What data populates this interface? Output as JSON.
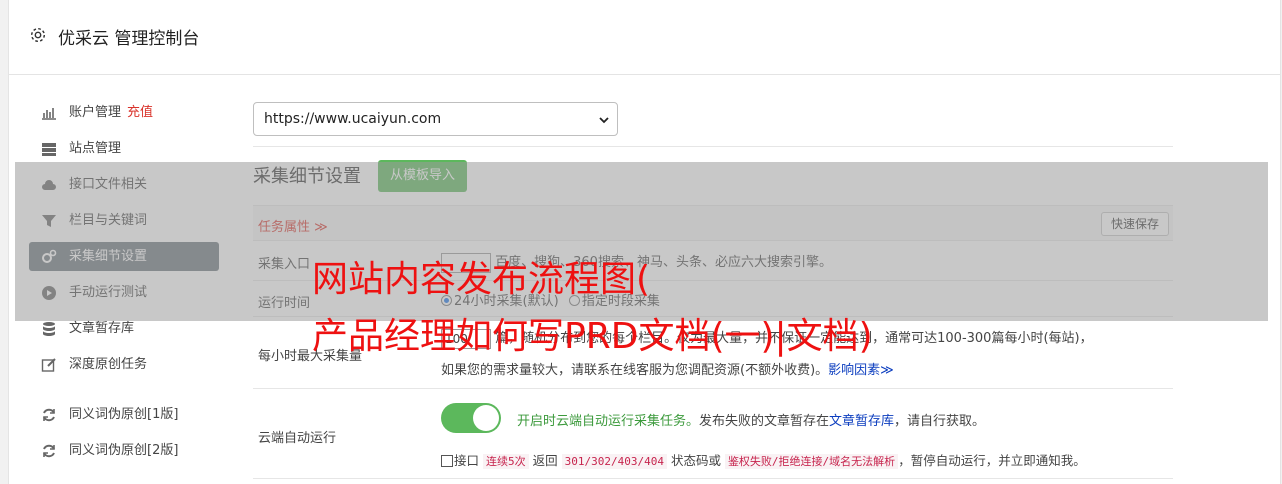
{
  "header": {
    "title": "优采云 管理控制台"
  },
  "sidebar": {
    "items": [
      {
        "label": "账户管理",
        "badge": "充值"
      },
      {
        "label": "站点管理"
      },
      {
        "label": "接口文件相关"
      },
      {
        "label": "栏目与关键词"
      },
      {
        "label": "采集细节设置"
      },
      {
        "label": "手动运行测试"
      },
      {
        "label": "文章暂存库"
      },
      {
        "label": "深度原创任务"
      },
      {
        "label": "同义词伪原创[1版]"
      },
      {
        "label": "同义词伪原创[2版]"
      }
    ]
  },
  "main": {
    "site_url": "https://www.ucaiyun.com",
    "section_title": "采集细节设置",
    "template_button": "从模板导入",
    "attr_header": "任务属性 ≫",
    "quick_save": "快速保存",
    "entry": {
      "label": "采集入口",
      "text": "百度、搜狗、360搜索、神马、头条、必应六大搜索引擎。"
    },
    "time": {
      "label": "运行时间",
      "opt1": "24小时采集(默认)",
      "opt2": "指定时段采集"
    },
    "max": {
      "label": "每小时最大采集量",
      "value": "100",
      "line1": "篇，随机分布到您的每个栏目。仅为最大量，并不保证一定能达到，通常可达100-300篇每小时(每站)，",
      "line2a": "如果您的需求量较大，请联系在线客服为您调配资源(不额外收费)。",
      "line2_link": "影响因素",
      "line2_arrow": "≫"
    },
    "cloud": {
      "label": "云端自动运行",
      "enabled_text": "开启时云端自动运行采集任务。",
      "desc_a": "发布失败的文章暂存在",
      "desc_link": "文章暂存库",
      "desc_b": "，请自行获取。",
      "l2_a": "接口",
      "l2_code1": "连续5次",
      "l2_b": "返回",
      "l2_code2": "301/302/403/404",
      "l2_c": "状态码或",
      "l2_code3": "鉴权失败/拒绝连接/域名无法解析",
      "l2_d": "，暂停自动运行，并立即通知我。"
    }
  },
  "watermark": {
    "line1": "网站内容发布流程图(",
    "line2": "产品经理如何写PRD文档(一)|文档)"
  }
}
